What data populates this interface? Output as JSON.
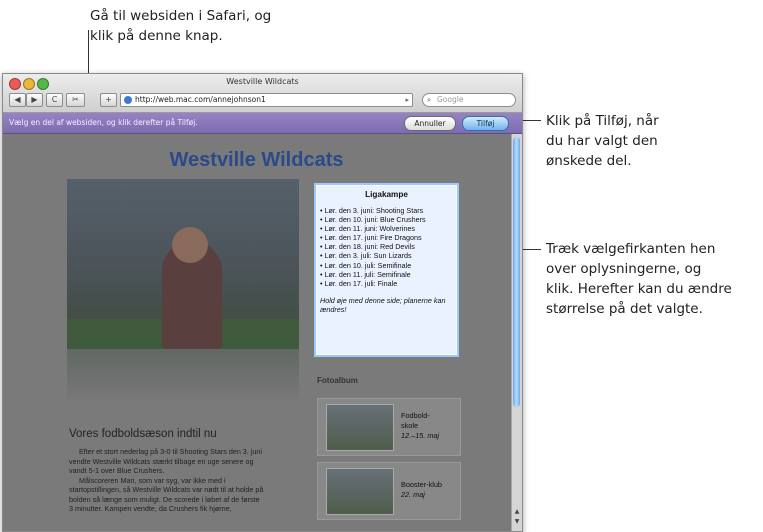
{
  "callouts": {
    "top": [
      "Gå til websiden i Safari, og",
      "klik på denne knap."
    ],
    "right1": [
      "Klik på Tilføj, når",
      "du har valgt den",
      "ønskede del."
    ],
    "right2": [
      "Træk vælgefirkanten hen",
      "over oplysningerne, og",
      "klik. Herefter kan du ændre",
      "størrelse på det valgte."
    ]
  },
  "window": {
    "title": "Westville Wildcats",
    "url": "http://web.mac.com/annejohnson1",
    "search_placeholder": "Google",
    "nav": {
      "back": "◀",
      "forward": "▶",
      "reload": "C",
      "webclip": "✂",
      "add": "+"
    }
  },
  "selection_bar": {
    "message": "Vælg en del af websiden, og klik derefter på Tilføj.",
    "cancel": "Annuller",
    "add": "Tilføj"
  },
  "page": {
    "title": "Westville Wildcats",
    "league": {
      "heading": "Ligakampe",
      "items": [
        "• Lør. den 3. juni: Shooting Stars",
        "• Lør. den 10. juni: Blue Crushers",
        "• Lør. den 11. juni: Wolverines",
        "• Lør. den 17. juni: Fire Dragons",
        "• Lør. den 18. juni: Red Devils",
        "• Lør. den 3. juli: Sun Lizards",
        "• Lør. den 10. juli: Semifinale",
        "• Lør. den 11. juli: Semifinale",
        "• Lør. den 17. juli: Finale"
      ],
      "note": "Hold øje med denne side; planerne kan ændres!"
    },
    "album": {
      "heading": "Fotoalbum",
      "items": [
        {
          "title1": "Fodbold-",
          "title2": "skole",
          "date": "12.–15. maj"
        },
        {
          "title1": "Booster-klub",
          "title2": "",
          "date": "22. maj"
        }
      ]
    },
    "season_heading": "Vores fodboldsæson indtil nu",
    "body_lines": [
      "Efter et stort nederlag på 3-0 til Shooting Stars den 3. juni",
      "vendte Westville Wildcats stærkt tilbage en uge senere og",
      "vandt 5-1 over Blue Crushers.",
      "Målscoreren Mari, som var syg, var ikke med i",
      "startopstillingen, så Westville Wildcats var nødt til at holde på",
      "bolden så længe som muligt. De scorede i løbet af de første",
      "3 minutter. Kampen vendte, da Crushers fik hjørne,"
    ]
  }
}
